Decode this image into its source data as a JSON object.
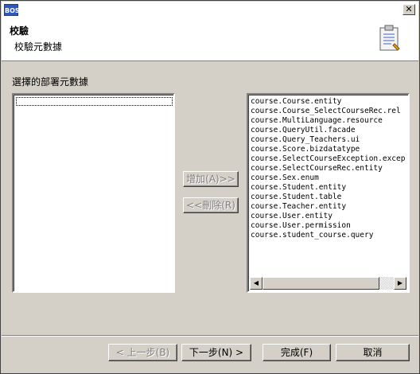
{
  "window": {
    "app_icon_text": "BOS",
    "close_glyph": "✕"
  },
  "header": {
    "title": "校驗",
    "subtitle": "校驗元數據",
    "icon": "clipboard-icon"
  },
  "section_label": "選擇的部署元數據",
  "left_list": {
    "items": []
  },
  "right_list": {
    "items": [
      "course.Course.entity",
      "course.Course_SelectCourseRec.rel",
      "course.MultiLanguage.resource",
      "course.QueryUtil.facade",
      "course.Query_Teachers.ui",
      "course.Score.bizdatatype",
      "course.SelectCourseException.excep",
      "course.SelectCourseRec.entity",
      "course.Sex.enum",
      "course.Student.entity",
      "course.Student.table",
      "course.Teacher.entity",
      "course.User.entity",
      "course.User.permission",
      "course.student_course.query"
    ],
    "scroll_left": "◀",
    "scroll_right": "▶"
  },
  "buttons": {
    "add": "增加(A)>>",
    "remove": "<<刪除(R)",
    "back": "< 上一步(B)",
    "next": "下一步(N) >",
    "finish": "完成(F)",
    "cancel": "取消"
  },
  "colors": {
    "dialog_bg": "#d4d0c8",
    "header_bg": "#ffffff",
    "icon_blue": "#2f58b8"
  }
}
